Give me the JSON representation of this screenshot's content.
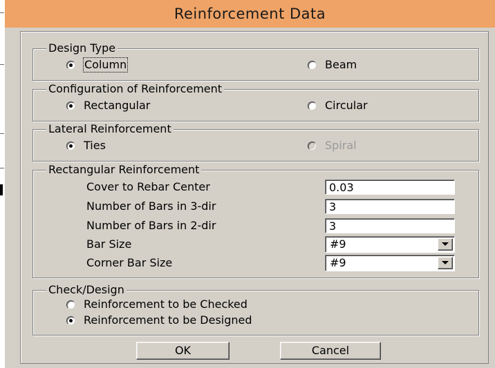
{
  "window": {
    "title": "Reinforcement Data"
  },
  "design_type": {
    "legend": "Design Type",
    "options": [
      {
        "label": "Column",
        "selected": true
      },
      {
        "label": "Beam",
        "selected": false
      }
    ]
  },
  "configuration": {
    "legend": "Configuration of Reinforcement",
    "options": [
      {
        "label": "Rectangular",
        "selected": true
      },
      {
        "label": "Circular",
        "selected": false
      }
    ]
  },
  "lateral": {
    "legend": "Lateral Reinforcement",
    "options": [
      {
        "label": "Ties",
        "selected": true
      },
      {
        "label": "Spiral",
        "selected": false,
        "disabled": true
      }
    ]
  },
  "rectangular": {
    "legend": "Rectangular Reinforcement",
    "cover_label": "Cover to Rebar Center",
    "cover_value": "0.03",
    "bars3_label": "Number of Bars in 3-dir",
    "bars3_value": "3",
    "bars2_label": "Number of Bars in 2-dir",
    "bars2_value": "3",
    "bar_size_label": "Bar Size",
    "bar_size_value": "#9",
    "corner_bar_size_label": "Corner Bar Size",
    "corner_bar_size_value": "#9"
  },
  "check_design": {
    "legend": "Check/Design",
    "options": [
      {
        "label": "Reinforcement to be Checked",
        "selected": false
      },
      {
        "label": "Reinforcement to be Designed",
        "selected": true
      }
    ]
  },
  "buttons": {
    "ok": "OK",
    "cancel": "Cancel"
  },
  "colors": {
    "titlebar": "#efa366",
    "dialog_face": "#d4d0c8"
  }
}
